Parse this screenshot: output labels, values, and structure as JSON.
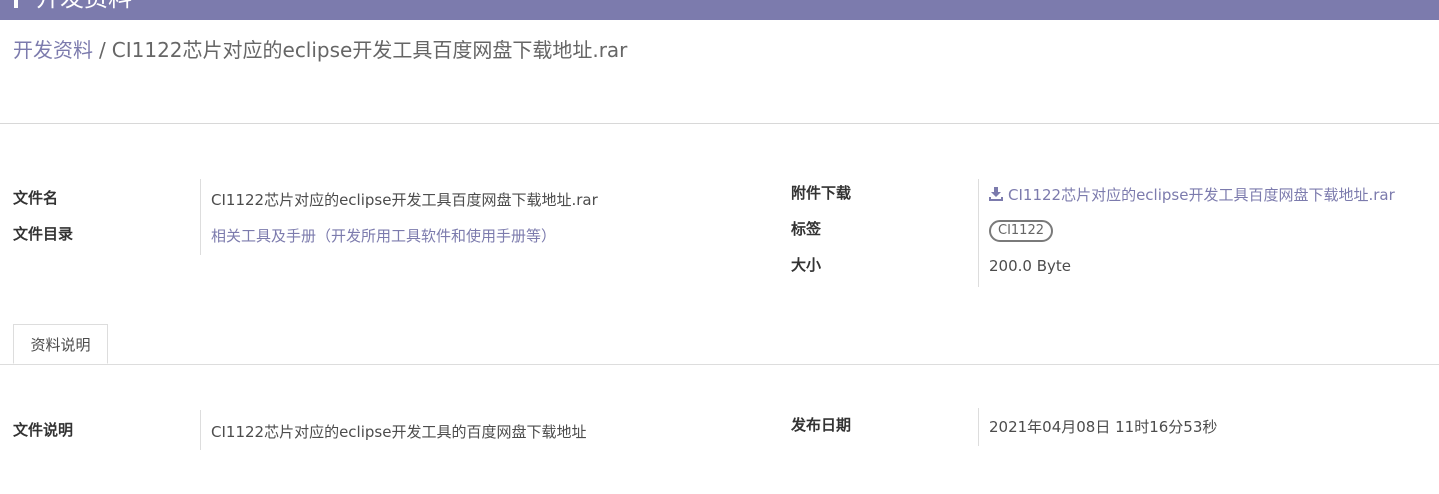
{
  "header": {
    "title": "开发资料"
  },
  "breadcrumb": {
    "parent": "开发资料",
    "separator": "/",
    "current": "CI1122芯片对应的eclipse开发工具百度网盘下载地址.rar"
  },
  "fields": {
    "file_name": {
      "label": "文件名",
      "value": "CI1122芯片对应的eclipse开发工具百度网盘下载地址.rar"
    },
    "file_dir": {
      "label": "文件目录",
      "value": "相关工具及手册（开发所用工具软件和使用手册等）"
    },
    "attachment": {
      "label": "附件下载",
      "value": "CI1122芯片对应的eclipse开发工具百度网盘下载地址.rar",
      "icon": "download-icon"
    },
    "tags": {
      "label": "标签",
      "items": [
        "CI1122"
      ]
    },
    "size": {
      "label": "大小",
      "value": "200.0 Byte"
    }
  },
  "tabs": [
    {
      "label": "资料说明",
      "active": true
    }
  ],
  "description": {
    "file_desc": {
      "label": "文件说明",
      "value": "CI1122芯片对应的eclipse开发工具的百度网盘下载地址"
    },
    "publish_date": {
      "label": "发布日期",
      "value": "2021年04月08日 11时16分53秒"
    }
  },
  "colors": {
    "accent": "#7c7bad",
    "label_text": "#333333",
    "body_text": "#4c4c4c",
    "divider": "#dddddd"
  }
}
